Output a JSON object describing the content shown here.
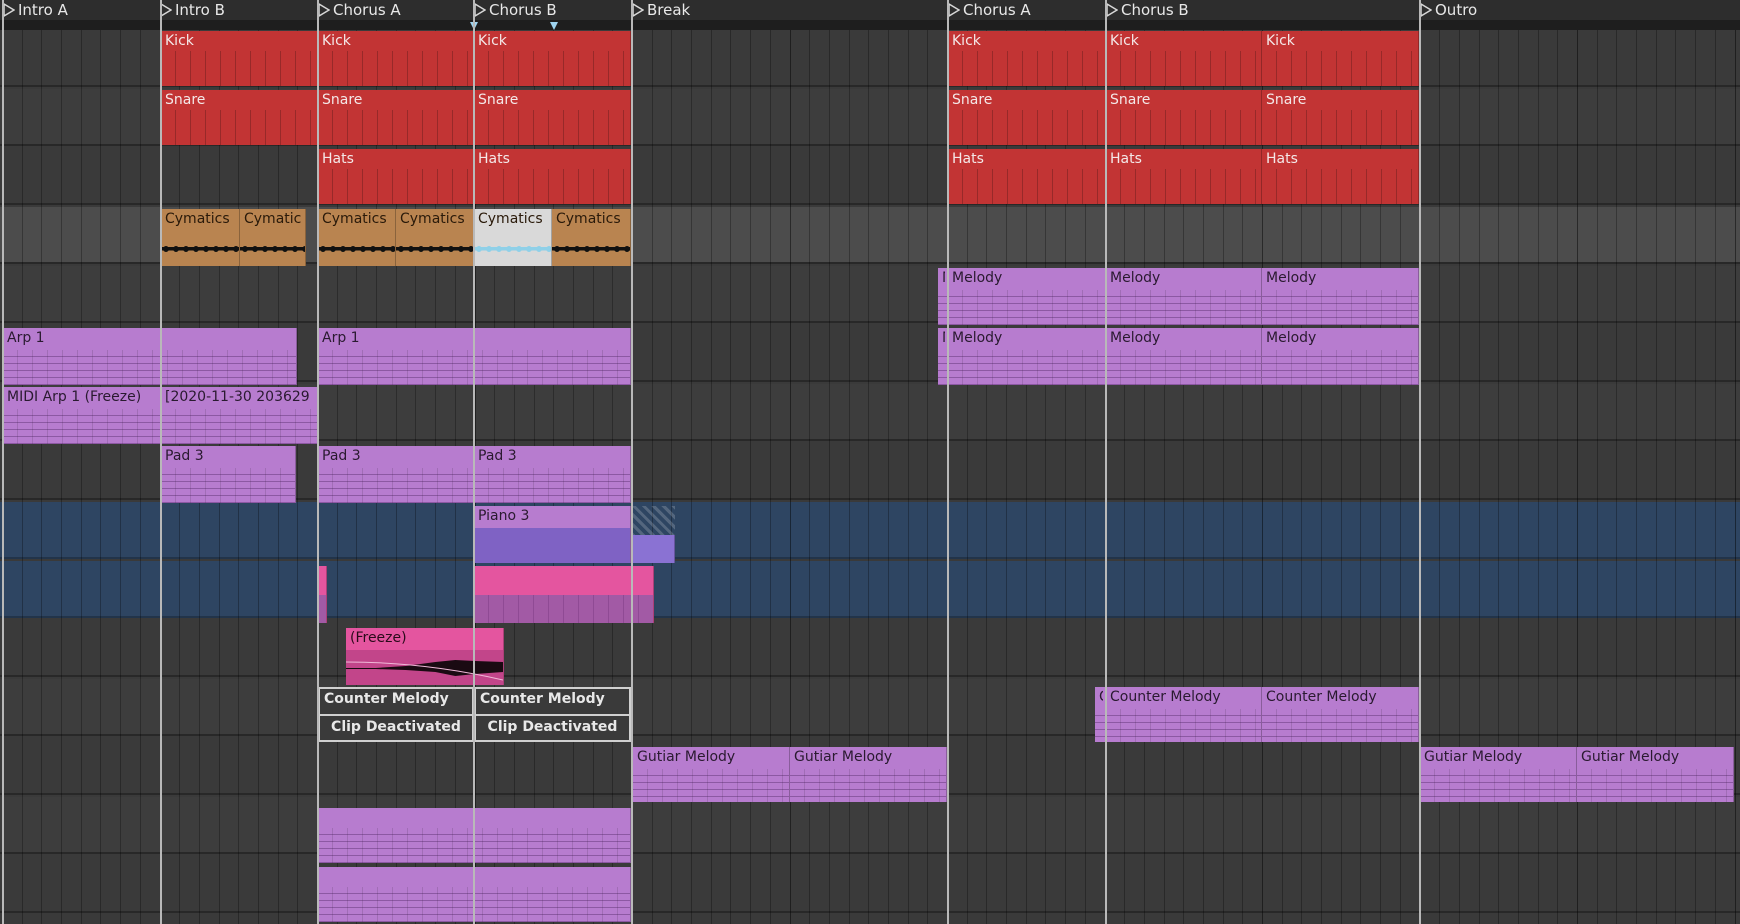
{
  "locators": [
    {
      "label": "Intro A"
    },
    {
      "label": "Intro B"
    },
    {
      "label": "Chorus A"
    },
    {
      "label": "Chorus B"
    },
    {
      "label": "Break"
    },
    {
      "label": "Chorus A"
    },
    {
      "label": "Chorus B"
    },
    {
      "label": "Outro"
    }
  ],
  "clips": {
    "kick": "Kick",
    "snare": "Snare",
    "hats": "Hats",
    "cymatics": "Cymatics",
    "cymatics_cut": "Cymatic",
    "melody": "Melody",
    "melody_cut": "M",
    "arp1": "Arp 1",
    "midi_arp_freeze": "MIDI Arp 1 (Freeze)",
    "arp_bounce": "[2020-11-30 203629",
    "pad3": "Pad 3",
    "piano3": "Piano 3",
    "freeze": "(Freeze)",
    "counter_melody": "Counter Melody",
    "counter_melody_cut": "C",
    "clip_deactivated": "Clip Deactivated",
    "guitar_melody": "Gutiar Melody"
  },
  "colors": {
    "drums": "#c23434",
    "midi": "#b77ccf",
    "audio": "#b98450",
    "pink": "#e4559f",
    "blue_lane": "#2e4562"
  }
}
